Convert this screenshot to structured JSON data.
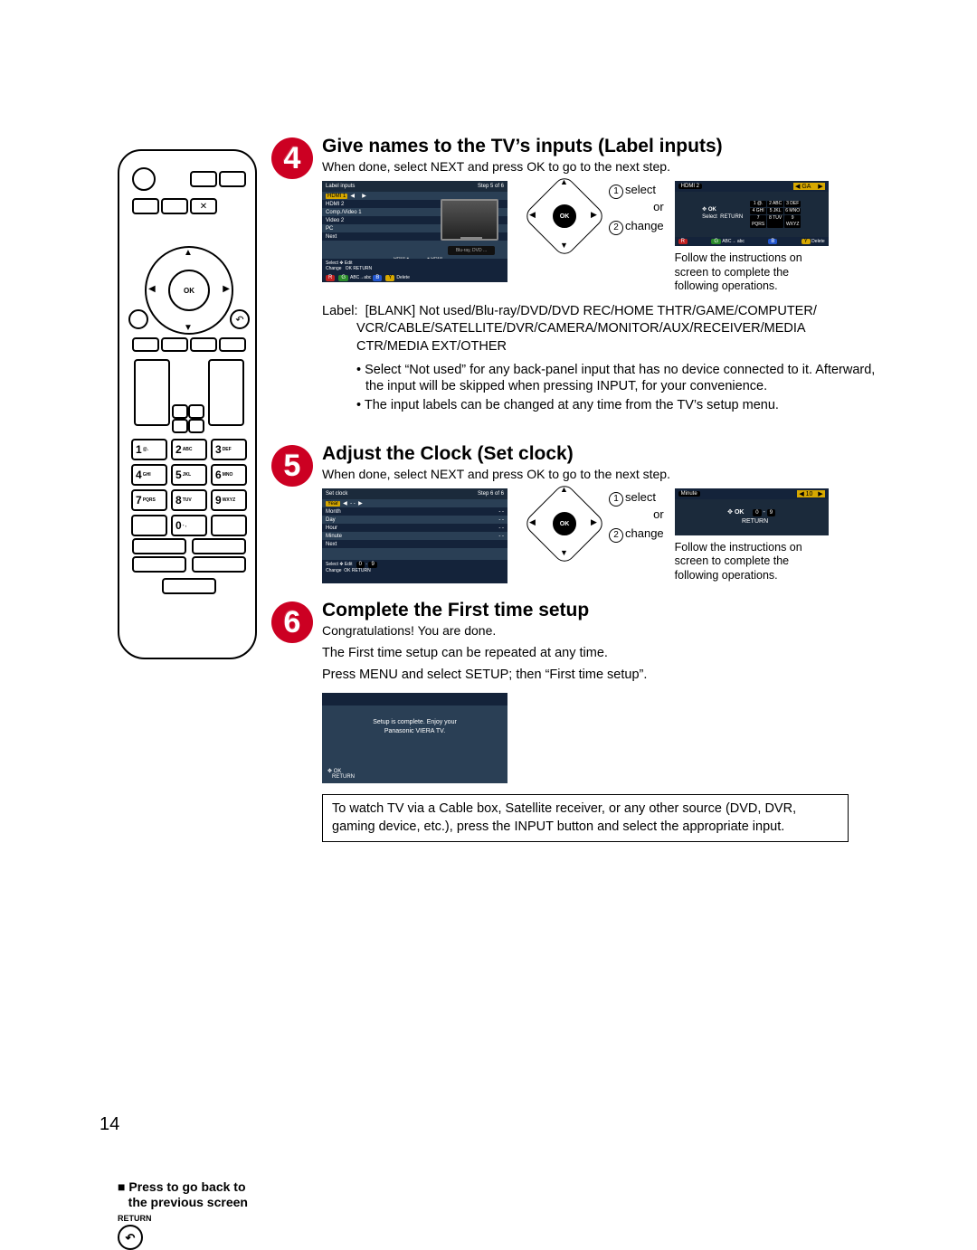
{
  "page_number": "14",
  "remote": {
    "ok": "OK",
    "keypad": [
      {
        "n": "1",
        "sub": "@."
      },
      {
        "n": "2",
        "sub": "ABC"
      },
      {
        "n": "3",
        "sub": "DEF"
      },
      {
        "n": "4",
        "sub": "GHI"
      },
      {
        "n": "5",
        "sub": "JKL"
      },
      {
        "n": "6",
        "sub": "MNO"
      },
      {
        "n": "7",
        "sub": "PQRS"
      },
      {
        "n": "8",
        "sub": "TUV"
      },
      {
        "n": "9",
        "sub": "WXYZ"
      },
      {
        "n": "",
        "sub": ""
      },
      {
        "n": "0",
        "sub": "- ,"
      },
      {
        "n": "",
        "sub": ""
      }
    ],
    "prev_note_line1": "Press to go back to",
    "prev_note_line2": "the previous screen",
    "return_label": "RETURN"
  },
  "step4": {
    "num": "4",
    "title": "Give names to the TV’s inputs (Label inputs)",
    "sub": "When done, select NEXT and press OK to go to the next step.",
    "screen": {
      "title": "Label inputs",
      "step": "Step 5 of 6",
      "rows": [
        "HDMI 1",
        "HDMI 2",
        "Comp./Video 1",
        "Video 2",
        "PC",
        "Next"
      ],
      "bluray": "Blu-ray, DVD ...",
      "hdmi_in": "HDMI",
      "hdmi_out": "HDMI",
      "hint_select": "Select",
      "hint_change": "Change",
      "hint_edit": "Edit",
      "hint_ok": "OK",
      "hint_return": "RETURN",
      "hint_abc": "ABC→abc",
      "hint_delete": "Delete"
    },
    "dpad": {
      "ok": "OK",
      "sel": "select",
      "chg": "change",
      "or": "or"
    },
    "mini": {
      "field": "HDMI 2",
      "value": "GA",
      "ok": "OK",
      "select": "Select",
      "return": "RETURN",
      "abc": "ABC→ abc",
      "delete": "Delete",
      "r": "R",
      "g": "G",
      "b": "B",
      "y": "Y",
      "k1": "1 @.",
      "k2": "2 ABC",
      "k3": "3 DEF",
      "k4": "4 GHI",
      "k5": "5 JKL",
      "k6": "6 MNO",
      "k7": "7 PQRS",
      "k8": "8 TUV",
      "k9": "9 WXYZ"
    },
    "follow": "Follow the instructions on screen to complete the following operations.",
    "label_prefix": "Label:",
    "label_line1": "[BLANK] Not used/Blu-ray/DVD/DVD REC/HOME THTR/GAME/COMPUTER/",
    "label_line2": "VCR/CABLE/SATELLITE/DVR/CAMERA/MONITOR/AUX/RECEIVER/MEDIA",
    "label_line3": "CTR/MEDIA EXT/OTHER",
    "bullets": [
      "Select “Not used” for any back-panel input that has no device connected to it. Afterward, the input will be skipped when pressing INPUT, for your convenience.",
      "The input labels can be changed at any time from the TV’s setup menu."
    ]
  },
  "step5": {
    "num": "5",
    "title": "Adjust the Clock (Set clock)",
    "sub": "When done, select NEXT and press OK to go to the next step.",
    "screen": {
      "title": "Set clock",
      "step": "Step 6 of 6",
      "rows": [
        "Year",
        "Month",
        "Day",
        "Hour",
        "Minute",
        "Next"
      ],
      "hint_select": "Select",
      "hint_change": "Change",
      "hint_edit": "Edit",
      "hint_ok": "OK",
      "hint_return": "RETURN"
    },
    "dpad": {
      "ok": "OK",
      "sel": "select",
      "chg": "change",
      "or": "or"
    },
    "mini": {
      "field": "Minute",
      "value": "10",
      "ok": "OK",
      "return": "RETURN",
      "k0": "0",
      "k9": "9",
      "dash": "-"
    },
    "follow": "Follow the instructions on screen to complete the following operations."
  },
  "step6": {
    "num": "6",
    "title": "Complete the First time setup",
    "congrats": "Congratulations!  You are done.",
    "p1": "The First time setup can be repeated at any time.",
    "p2": "Press MENU and select SETUP; then “First time setup”.",
    "screen": {
      "msg1": "Setup is complete. Enjoy your",
      "msg2": "Panasonic VIERA TV.",
      "ok": "OK",
      "return": "RETURN"
    },
    "finish_box": "To watch TV via a Cable box, Satellite receiver, or  any other source (DVD, DVR, gaming device, etc.), press the INPUT button and select the appropriate input."
  }
}
